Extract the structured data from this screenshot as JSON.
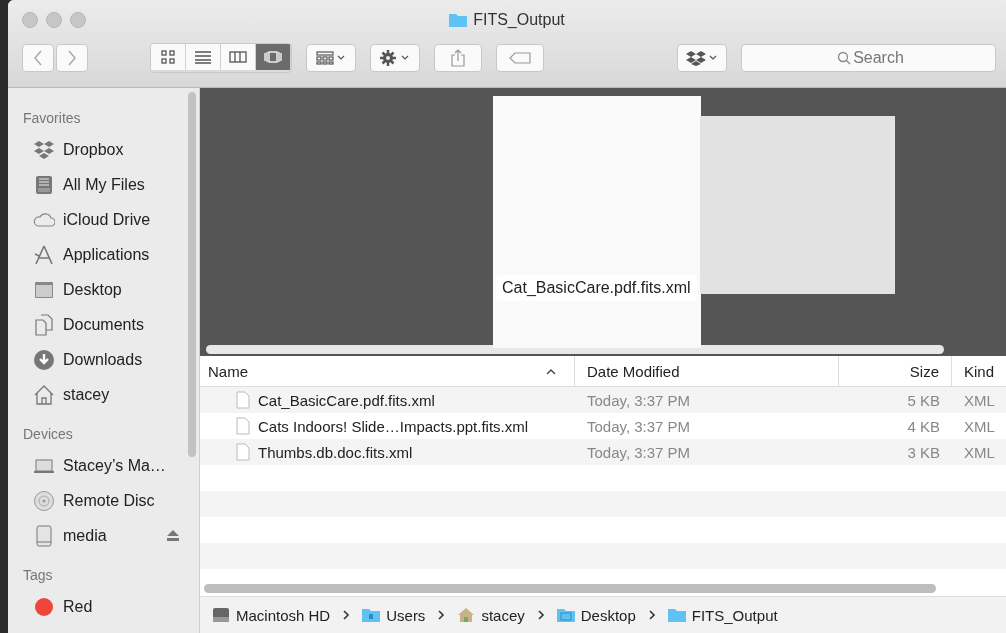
{
  "window": {
    "title": "FITS_Output"
  },
  "toolbar": {
    "view_modes": [
      {
        "kind": "icons",
        "selected": false
      },
      {
        "kind": "list",
        "selected": false
      },
      {
        "kind": "columns",
        "selected": false
      },
      {
        "kind": "coverflow",
        "selected": true
      }
    ],
    "search": {
      "placeholder": "Search"
    }
  },
  "sidebar": {
    "sections": [
      {
        "title": "Favorites",
        "items": [
          {
            "kind": "dropbox",
            "label": "Dropbox"
          },
          {
            "kind": "allfiles",
            "label": "All My Files"
          },
          {
            "kind": "cloud",
            "label": "iCloud Drive"
          },
          {
            "kind": "apps",
            "label": "Applications"
          },
          {
            "kind": "desktop",
            "label": "Desktop"
          },
          {
            "kind": "documents",
            "label": "Documents"
          },
          {
            "kind": "downloads",
            "label": "Downloads"
          },
          {
            "kind": "home",
            "label": "stacey"
          }
        ]
      },
      {
        "title": "Devices",
        "items": [
          {
            "kind": "laptop",
            "label": "Stacey’s Ma…"
          },
          {
            "kind": "disc",
            "label": "Remote Disc"
          },
          {
            "kind": "drive",
            "label": "media",
            "eject": true
          }
        ]
      },
      {
        "title": "Tags",
        "items": [
          {
            "kind": "tag",
            "label": "Red",
            "color": "#f0453a"
          }
        ]
      }
    ]
  },
  "preview": {
    "caption": "Cat_BasicCare.pdf.fits.xml"
  },
  "table": {
    "columns": [
      "Name",
      "Date Modified",
      "Size",
      "Kind"
    ],
    "rows": [
      {
        "name": "Cat_BasicCare.pdf.fits.xml",
        "date": "Today, 3:37 PM",
        "size": "5 KB",
        "kind": "XML"
      },
      {
        "name": "Cats Indoors! Slide…Impacts.ppt.fits.xml",
        "date": "Today, 3:37 PM",
        "size": "4 KB",
        "kind": "XML"
      },
      {
        "name": "Thumbs.db.doc.fits.xml",
        "date": "Today, 3:37 PM",
        "size": "3 KB",
        "kind": "XML"
      }
    ]
  },
  "path_bar": [
    {
      "kind": "disk",
      "label": "Macintosh HD"
    },
    {
      "kind": "users",
      "label": "Users"
    },
    {
      "kind": "home",
      "label": "stacey"
    },
    {
      "kind": "desktop",
      "label": "Desktop"
    },
    {
      "kind": "folder",
      "label": "FITS_Output"
    }
  ]
}
